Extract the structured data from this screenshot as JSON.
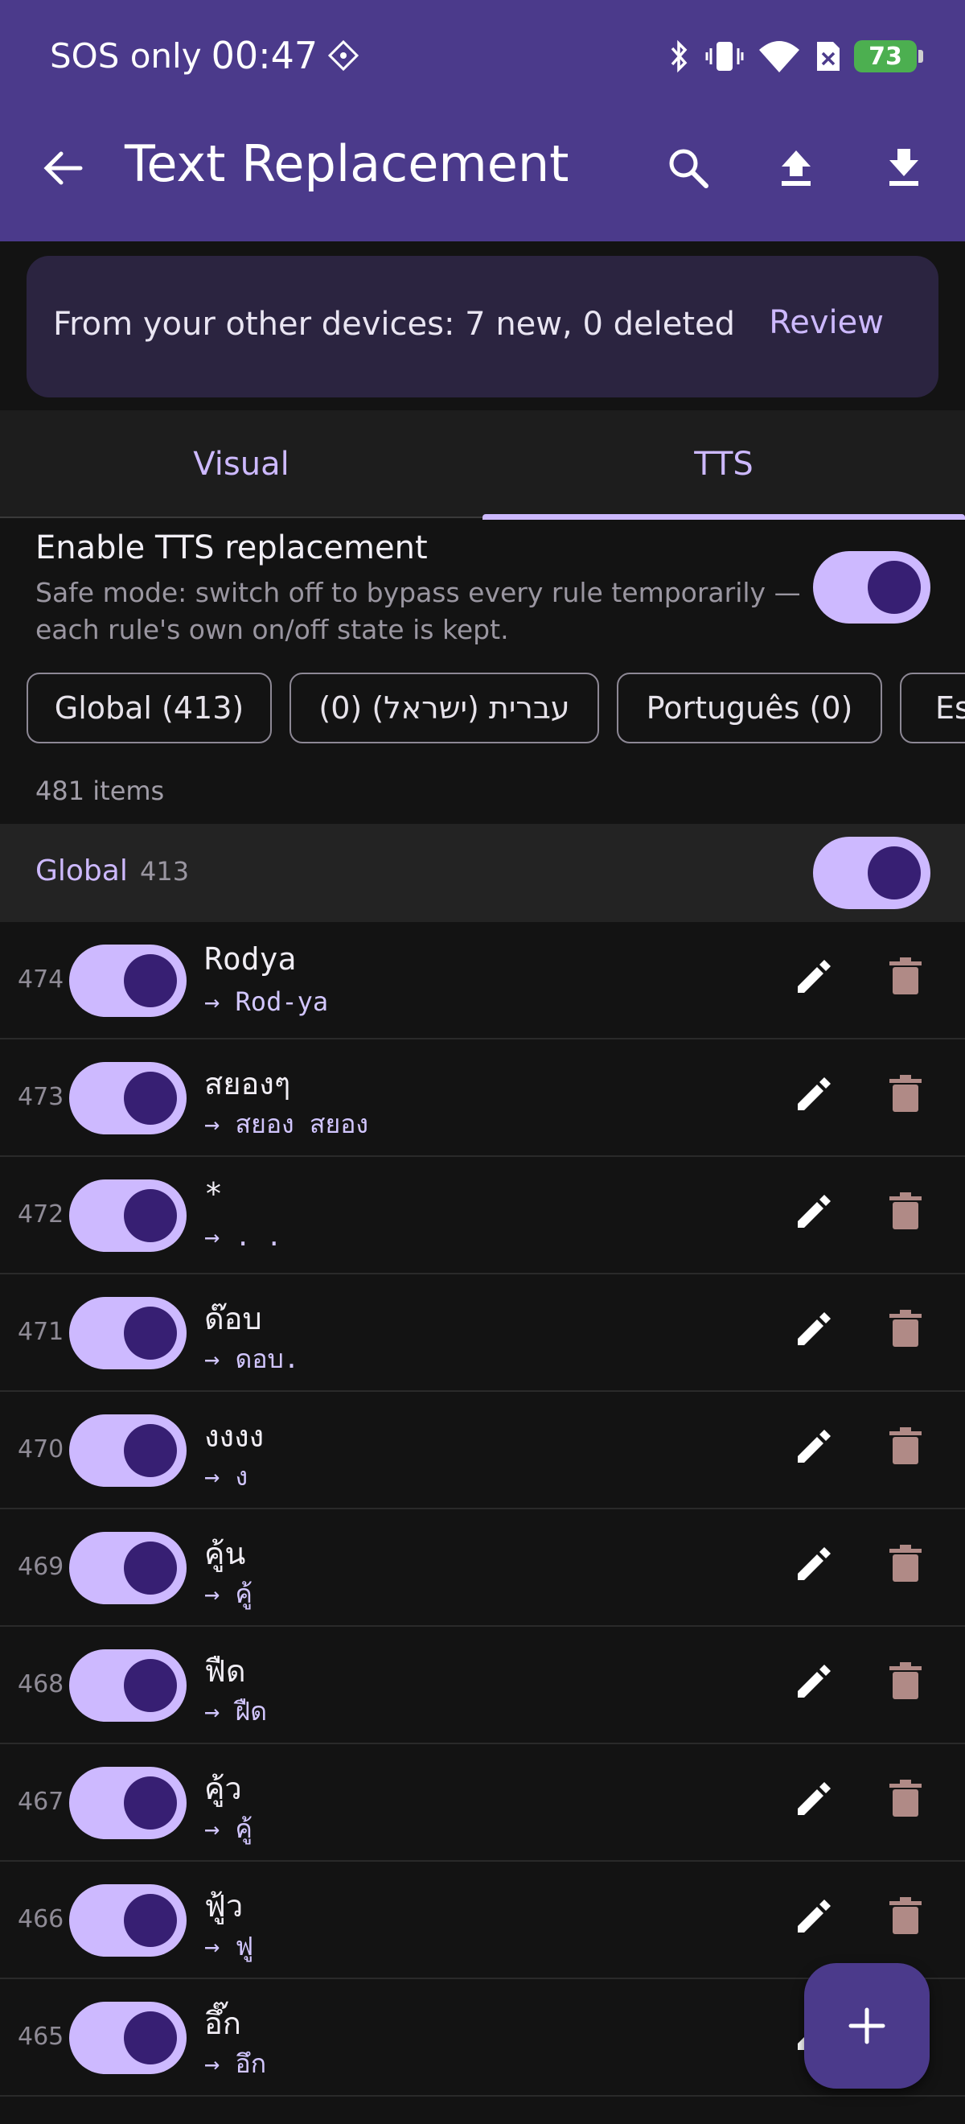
{
  "status_bar": {
    "carrier": "SOS only",
    "time": "00:47",
    "battery": "73"
  },
  "app_bar": {
    "title": "Text Replacement"
  },
  "banner": {
    "message": "From your other devices: 7 new, 0 deleted",
    "action": "Review"
  },
  "tabs": [
    {
      "label": "Visual",
      "active": false
    },
    {
      "label": "TTS",
      "active": true
    }
  ],
  "enable": {
    "title": "Enable TTS replacement",
    "subtitle": "Safe mode: switch off to bypass every rule temporarily — each rule's own on/off state is kept.",
    "on": true
  },
  "chips": [
    "Global (413)",
    "(0) (עברית (ישראל",
    "Português (0)",
    "Es"
  ],
  "item_count": "481 items",
  "group": {
    "name": "Global",
    "count": "413",
    "on": true
  },
  "rows": [
    {
      "index": "474",
      "from": "Rodya",
      "to": "→ Rod-ya"
    },
    {
      "index": "473",
      "from": "สยองๆ",
      "to": "→ สยอง สยอง"
    },
    {
      "index": "472",
      "from": "*",
      "to": "→ . ."
    },
    {
      "index": "471",
      "from": "ด๊อบ",
      "to": "→ ดอบ."
    },
    {
      "index": "470",
      "from": "งงงง",
      "to": "→ ง"
    },
    {
      "index": "469",
      "from": "คู้น",
      "to": "→ คู้"
    },
    {
      "index": "468",
      "from": "ฟืด",
      "to": "→ ฝืด"
    },
    {
      "index": "467",
      "from": "คู้ว",
      "to": "→ คู้"
    },
    {
      "index": "466",
      "from": "ฟู้ว",
      "to": "→ ฟู"
    },
    {
      "index": "465",
      "from": "อึ๊ก",
      "to": "→ อึก"
    }
  ],
  "colors": {
    "app_bar": "#4b3a8b",
    "accent": "#cdb9ff",
    "switch_knob": "#371f73",
    "background": "#131313",
    "delete_icon": "#b08a86"
  }
}
